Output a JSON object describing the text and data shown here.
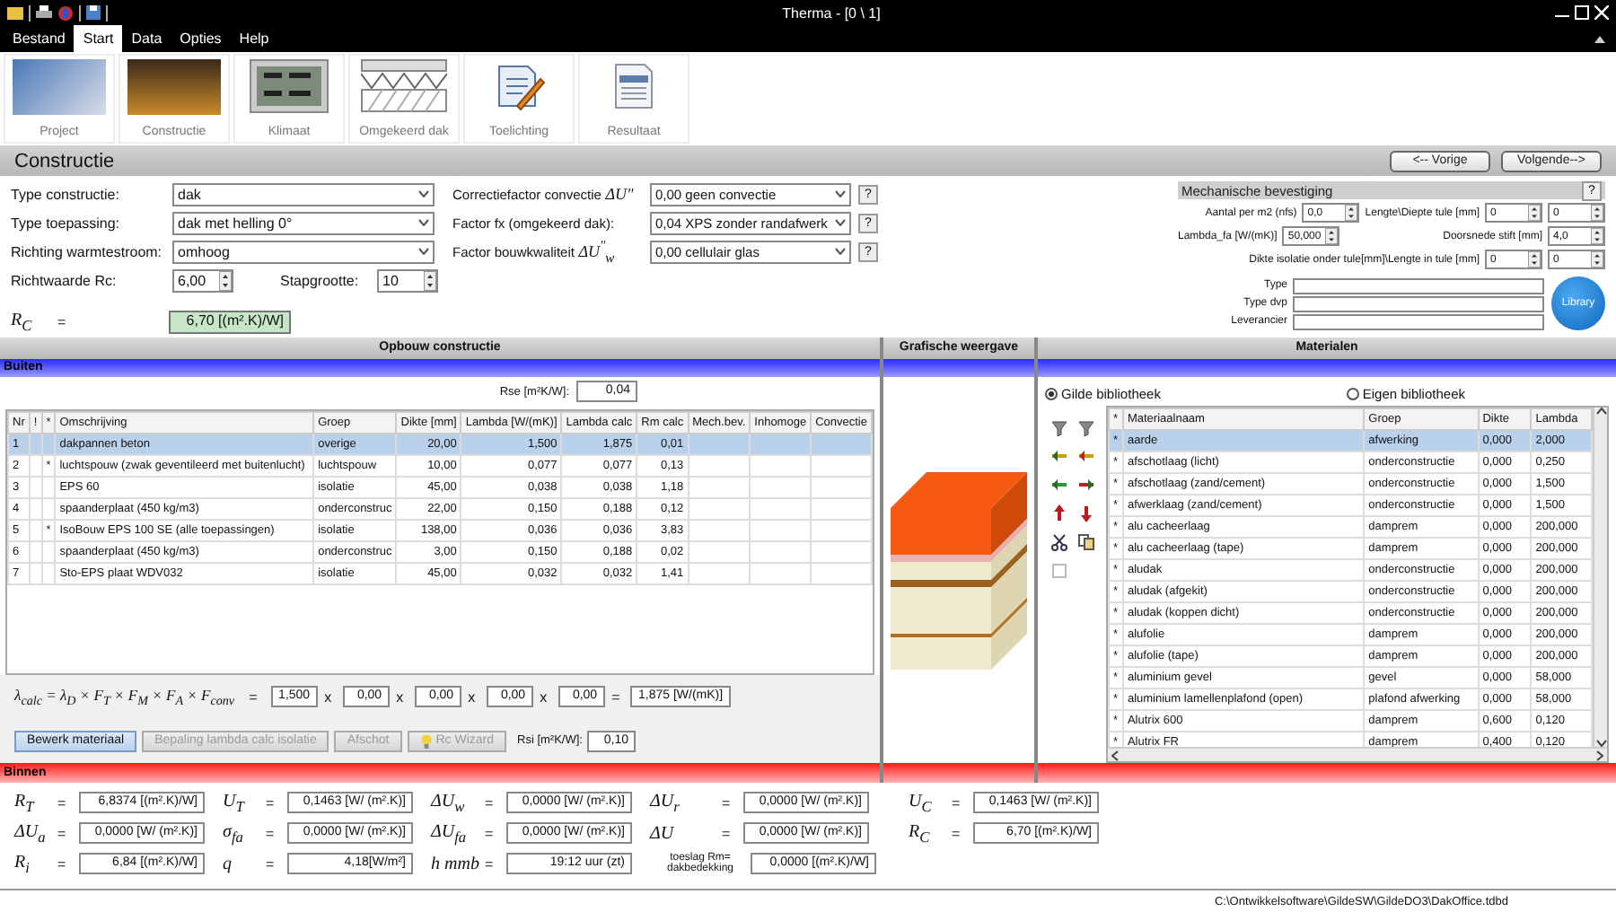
{
  "window": {
    "title": "Therma - [0 \\ 1]"
  },
  "menu": [
    {
      "label": "Bestand",
      "selected": false
    },
    {
      "label": "Start",
      "selected": true
    },
    {
      "label": "Data",
      "selected": false
    },
    {
      "label": "Opties",
      "selected": false
    },
    {
      "label": "Help",
      "selected": false
    }
  ],
  "ribbon": [
    {
      "label": "Project",
      "kind": "photo"
    },
    {
      "label": "Constructie",
      "kind": "photo"
    },
    {
      "label": "Klimaat",
      "kind": "display"
    },
    {
      "label": "Omgekeerd dak",
      "kind": "roof"
    },
    {
      "label": "Toelichting",
      "kind": "notes"
    },
    {
      "label": "Resultaat",
      "kind": "document"
    }
  ],
  "page": {
    "title": "Constructie",
    "buttons": [
      "<-- Vorige",
      "Volgende-->"
    ]
  },
  "form": {
    "selects": [
      {
        "label": "Type constructie:",
        "value": "dak"
      },
      {
        "label": "Type toepassing:",
        "value": "dak met helling 0°"
      },
      {
        "label": "Richting warmtestroom:",
        "value": "omhoog"
      }
    ],
    "rc_target": {
      "label": "Richtwaarde Rc:",
      "value": "6,00"
    },
    "step": {
      "label": "Stapgrootte:",
      "value": "10"
    },
    "rc": {
      "symbol": "R$_{C}$",
      "eq": "=",
      "value": "6,70 [(m².K)/W]"
    },
    "factors": [
      {
        "label": "Correctiefactor convectie",
        "symbol": "ΔU\"",
        "value": "0,00 geen convectie",
        "help": "?"
      },
      {
        "label": "Factor fx (omgekeerd dak):",
        "value": "0,04 XPS zonder randafwerk",
        "help": "?"
      },
      {
        "label": "Factor bouwkwaliteit",
        "symbol": "ΔU$^{\"}$$_{w}$",
        "value": "0,00 cellulair glas",
        "help": "?"
      }
    ]
  },
  "mech": {
    "title": "Mechanische bevestiging",
    "help": "?",
    "settings": [
      {
        "label": "Aantal per m2 (nfs)",
        "values": [
          "0,0"
        ]
      },
      {
        "label": "Lengte\\Diepte tule [mm]",
        "values": [
          "0",
          "0"
        ]
      },
      {
        "label": "Lambda_fa [W/(mK)]",
        "values": [
          "50,000"
        ]
      },
      {
        "label": "Doorsnede stift [mm]",
        "values": [
          "4,0"
        ]
      },
      {
        "label": "Dikte isolatie onder tule[mm]\\Lengte in tule [mm]",
        "values": [
          "0",
          "0"
        ]
      }
    ],
    "fields": [
      "Type",
      "Type dvp",
      "Leverancier"
    ],
    "library": "Library"
  },
  "sections": [
    "Opbouw constructie",
    "Grafische weergave",
    "Materialen"
  ],
  "outside": "Buiten",
  "inside": "Binnen",
  "construction": {
    "rse": {
      "label": "Rse [m²K/W]:",
      "value": "0,04"
    },
    "columns": [
      "Nr",
      "!",
      "*",
      "Omschrijving",
      "Groep",
      "Dikte [mm]",
      "Lambda [W/(mK)]",
      "Lambda calc",
      "Rm calc",
      "Mech.bev.",
      "Inhomoge",
      "Convectie"
    ],
    "rows": [
      {
        "nr": "1",
        "name": "dakpannen beton",
        "group": "overige",
        "thickness": "20,00",
        "lambda": "1,500",
        "lambda_calc": "1,875",
        "rm": "0,01",
        "selected": true
      },
      {
        "nr": "2",
        "mark": "*",
        "name": "luchtspouw (zwak geventileerd met buitenlucht)",
        "group": "luchtspouw",
        "thickness": "10,00",
        "lambda": "0,077",
        "lambda_calc": "0,077",
        "rm": "0,13",
        "selected": false
      },
      {
        "nr": "3",
        "name": "EPS  60",
        "group": "isolatie",
        "thickness": "45,00",
        "lambda": "0,038",
        "lambda_calc": "0,038",
        "rm": "1,18",
        "selected": false
      },
      {
        "nr": "4",
        "name": "spaanderplaat (450 kg/m3)",
        "group": "onderconstruc",
        "thickness": "22,00",
        "lambda": "0,150",
        "lambda_calc": "0,188",
        "rm": "0,12",
        "selected": false
      },
      {
        "nr": "5",
        "mark": "*",
        "name": "IsoBouw EPS 100 SE (alle toepassingen)",
        "group": "isolatie",
        "thickness": "138,00",
        "lambda": "0,036",
        "lambda_calc": "0,036",
        "rm": "3,83",
        "selected": false
      },
      {
        "nr": "6",
        "name": "spaanderplaat (450 kg/m3)",
        "group": "onderconstruc",
        "thickness": "3,00",
        "lambda": "0,150",
        "lambda_calc": "0,188",
        "rm": "0,02",
        "selected": false
      },
      {
        "nr": "7",
        "name": "Sto-EPS plaat WDV032",
        "group": "isolatie",
        "thickness": "45,00",
        "lambda": "0,032",
        "lambda_calc": "0,032",
        "rm": "1,41",
        "selected": false
      }
    ],
    "formula": {
      "expr": "λ$_{calc}$ = λ$_{D}$ × F$_{T}$ × F$_{M}$ × F$_{A}$ × F$_{conv}$",
      "eq": "=",
      "factors": [
        "1,500",
        "0,00",
        "0,00",
        "0,00",
        "0,00"
      ],
      "operators": [
        "x",
        "x",
        "x",
        "x",
        "="
      ],
      "result": "1,875 [W/(mK)]"
    },
    "actions": [
      {
        "label": "Bewerk materiaal",
        "disabled": false,
        "kind": "plain"
      },
      {
        "label": "Bepaling lambda calc isolatie",
        "disabled": true,
        "kind": "plain"
      },
      {
        "label": "Afschot",
        "disabled": true,
        "kind": "plain"
      },
      {
        "label": "Rc Wizard",
        "disabled": true,
        "kind": "wizard"
      }
    ],
    "rsi": {
      "label": "Rsi [m²K/W]:",
      "value": "0,10"
    }
  },
  "materials": {
    "sources": [
      {
        "label": "Gilde bibliotheek",
        "selected": true
      },
      {
        "label": "Eigen bibliotheek",
        "selected": false
      }
    ],
    "columns": [
      "*",
      "Materiaalnaam",
      "Groep",
      "Dikte",
      "Lambda"
    ],
    "rows": [
      {
        "mark": "*",
        "name": "aarde",
        "group": "afwerking",
        "thickness": "0,000",
        "lambda": "2,000",
        "selected": true
      },
      {
        "mark": "*",
        "name": "afschotlaag (licht)",
        "group": "onderconstructie",
        "thickness": "0,000",
        "lambda": "0,250",
        "selected": false
      },
      {
        "mark": "*",
        "name": "afschotlaag (zand/cement)",
        "group": "onderconstructie",
        "thickness": "0,000",
        "lambda": "1,500",
        "selected": false
      },
      {
        "mark": "*",
        "name": "afwerklaag (zand/cement)",
        "group": "onderconstructie",
        "thickness": "0,000",
        "lambda": "1,500",
        "selected": false
      },
      {
        "mark": "*",
        "name": "alu cacheerlaag",
        "group": "damprem",
        "thickness": "0,000",
        "lambda": "200,000",
        "selected": false
      },
      {
        "mark": "*",
        "name": "alu cacheerlaag (tape)",
        "group": "damprem",
        "thickness": "0,000",
        "lambda": "200,000",
        "selected": false
      },
      {
        "mark": "*",
        "name": "aludak",
        "group": "onderconstructie",
        "thickness": "0,000",
        "lambda": "200,000",
        "selected": false
      },
      {
        "mark": "*",
        "name": "aludak (afgekit)",
        "group": "onderconstructie",
        "thickness": "0,000",
        "lambda": "200,000",
        "selected": false
      },
      {
        "mark": "*",
        "name": "aludak (koppen dicht)",
        "group": "onderconstructie",
        "thickness": "0,000",
        "lambda": "200,000",
        "selected": false
      },
      {
        "mark": "*",
        "name": "alufolie",
        "group": "damprem",
        "thickness": "0,000",
        "lambda": "200,000",
        "selected": false
      },
      {
        "mark": "*",
        "name": "alufolie (tape)",
        "group": "damprem",
        "thickness": "0,000",
        "lambda": "200,000",
        "selected": false
      },
      {
        "mark": "*",
        "name": "aluminium gevel",
        "group": "gevel",
        "thickness": "0,000",
        "lambda": "58,000",
        "selected": false
      },
      {
        "mark": "*",
        "name": "aluminium lamellenplafond (open)",
        "group": "plafond afwerking",
        "thickness": "0,000",
        "lambda": "58,000",
        "selected": false
      },
      {
        "mark": "*",
        "name": "Alutrix 600",
        "group": "damprem",
        "thickness": "0,600",
        "lambda": "0,120",
        "selected": false
      },
      {
        "mark": "*",
        "name": "Alutrix FR",
        "group": "damprem",
        "thickness": "0,400",
        "lambda": "0,120",
        "selected": false
      }
    ]
  },
  "results": {
    "rows": [
      [
        {
          "kind": "symbol",
          "label": "R$_{T}$",
          "eq": "=",
          "value": "6,8374 [(m².K)/W]"
        },
        {
          "kind": "symbol",
          "label": "U$_{T}$",
          "eq": "=",
          "value": "0,1463 [W/ (m².K)]"
        },
        {
          "kind": "symbol",
          "label": "ΔU$_{w}$",
          "eq": "=",
          "value": "0,0000 [W/ (m².K)]"
        },
        {
          "kind": "symbol",
          "label": "ΔU$_{r}$",
          "eq": "=",
          "value": "0,0000 [W/ (m².K)]"
        }
      ],
      [
        {
          "kind": "symbol",
          "label": "ΔU$_{a}$",
          "eq": "=",
          "value": "0,0000 [W/ (m².K)]"
        },
        {
          "kind": "symbol",
          "label": "σ$_{fa}$",
          "eq": "=",
          "value": "0,0000 [W/ (m².K)]"
        },
        {
          "kind": "symbol",
          "label": "ΔU$_{fa}$",
          "eq": "=",
          "value": "0,0000 [W/ (m².K)]"
        },
        {
          "kind": "symbol",
          "label": "ΔU",
          "eq": "=",
          "value": "0,0000 [W/ (m².K)]"
        }
      ],
      [
        {
          "kind": "symbol",
          "label": "R$_{i}$",
          "eq": "=",
          "value": "6,84 [(m².K)/W]"
        },
        {
          "kind": "symbol",
          "label": "q",
          "eq": "=",
          "value": "4,18[W/m²]"
        },
        {
          "kind": "symbol",
          "label": "h mmb",
          "eq": "=",
          "value": "19:12 uur (zt)"
        },
        {
          "kind": "text",
          "label": "toeslag Rm= dakbedekking",
          "value": "0,0000 [(m².K)/W]"
        }
      ]
    ],
    "side": [
      {
        "kind": "symbol",
        "label": "U$_{C}$",
        "eq": "=",
        "value": "0,1463 [W/ (m².K)]"
      },
      {
        "kind": "symbol",
        "label": "R$_{C}$",
        "eq": "=",
        "value": "6,70 [(m².K)/W]"
      }
    ]
  },
  "status_bar": "C:\\Ontwikkelsoftware\\GildeSW\\GildeDO3\\DakOffice.tdbd"
}
